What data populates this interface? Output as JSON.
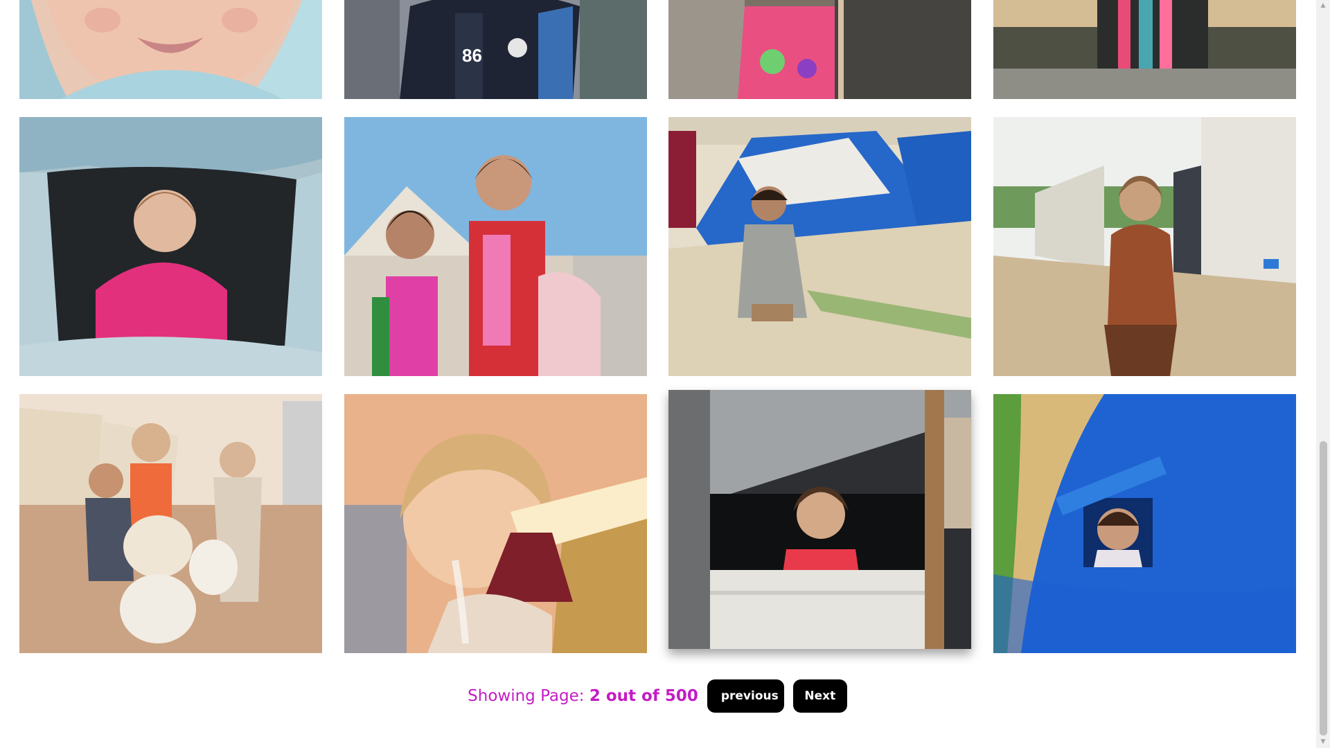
{
  "gallery": {
    "photos": [
      {
        "subject": "child-face-closeup",
        "row": 0,
        "col": 0
      },
      {
        "subject": "boy-blue-jacket",
        "row": 0,
        "col": 1
      },
      {
        "subject": "girl-pink-shirt",
        "row": 0,
        "col": 2
      },
      {
        "subject": "children-under-tent",
        "row": 0,
        "col": 3
      },
      {
        "subject": "girl-peeking-from-tent",
        "row": 1,
        "col": 0
      },
      {
        "subject": "two-girls-near-tents",
        "row": 1,
        "col": 1
      },
      {
        "subject": "boy-sitting-camp",
        "row": 1,
        "col": 2
      },
      {
        "subject": "girl-standing-camp-road",
        "row": 1,
        "col": 3
      },
      {
        "subject": "children-carrying-water",
        "row": 2,
        "col": 0
      },
      {
        "subject": "girl-drinking-water",
        "row": 2,
        "col": 1
      },
      {
        "subject": "girl-in-tent-window",
        "row": 2,
        "col": 2,
        "hovered": true
      },
      {
        "subject": "child-blue-tent-window",
        "row": 2,
        "col": 3
      }
    ]
  },
  "pagination": {
    "label": "Showing Page:",
    "status": "2 out of 500",
    "current_page": 2,
    "total_pages": 500,
    "previous_label": "previous",
    "next_label": "Next"
  },
  "colors": {
    "status_text": "#c41cc4",
    "button_bg": "#000000",
    "button_text": "#ffffff"
  }
}
